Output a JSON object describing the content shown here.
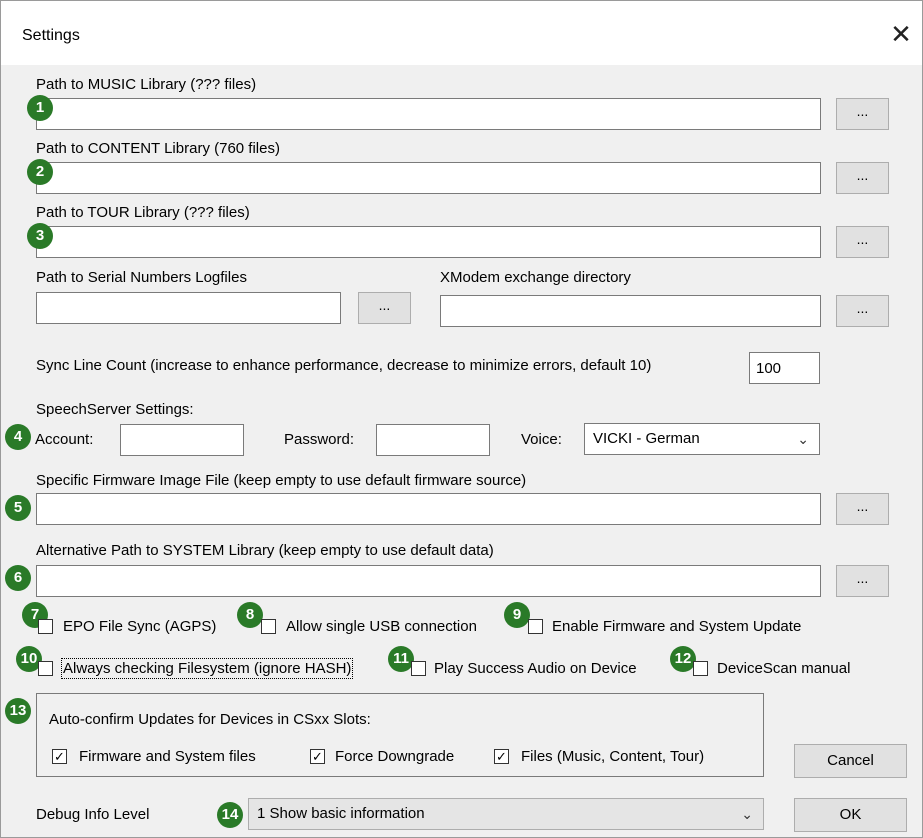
{
  "window": {
    "title": "Settings",
    "close_glyph": "✕"
  },
  "browse_label": "...",
  "music": {
    "label": "Path to MUSIC Library (??? files)",
    "value": "",
    "badge": "1"
  },
  "content": {
    "label": "Path to CONTENT Library (760 files)",
    "value": "",
    "badge": "2"
  },
  "tour": {
    "label": "Path to TOUR Library (??? files)",
    "value": "",
    "badge": "3"
  },
  "serial": {
    "label": "Path to Serial Numbers Logfiles",
    "value": ""
  },
  "xmodem": {
    "label": "XModem exchange directory",
    "value": ""
  },
  "sync": {
    "label": "Sync Line Count (increase to enhance performance, decrease to minimize errors, default 10)",
    "value": "100"
  },
  "speech": {
    "heading": "SpeechServer Settings:",
    "badge": "4",
    "account_label": "Account:",
    "account_value": "",
    "password_label": "Password:",
    "password_value": "",
    "voice_label": "Voice:",
    "voice_value": "VICKI - German"
  },
  "firmware": {
    "label": "Specific Firmware Image File (keep empty to use default firmware source)",
    "value": "",
    "badge": "5"
  },
  "system": {
    "label": "Alternative Path to SYSTEM Library (keep empty to use default data)",
    "value": "",
    "badge": "6"
  },
  "options": {
    "epo": {
      "label": "EPO File Sync (AGPS)",
      "badge": "7",
      "checked": false
    },
    "single_usb": {
      "label": "Allow single USB connection",
      "badge": "8",
      "checked": false
    },
    "enable_update": {
      "label": "Enable Firmware and System Update",
      "badge": "9",
      "checked": false
    },
    "always_check": {
      "label": "Always checking Filesystem (ignore HASH)",
      "badge": "10",
      "checked": false
    },
    "play_audio": {
      "label": "Play Success Audio on Device",
      "badge": "11",
      "checked": false
    },
    "devicescan": {
      "label": "DeviceScan manual",
      "badge": "12",
      "checked": false
    }
  },
  "autoconfirm": {
    "title": "Auto-confirm Updates for Devices in CSxx Slots:",
    "badge": "13",
    "firmware_files": {
      "label": "Firmware and System files",
      "checked": true
    },
    "force_downgrade": {
      "label": "Force Downgrade",
      "checked": true
    },
    "files": {
      "label": "Files (Music, Content, Tour)",
      "checked": true
    }
  },
  "debug": {
    "label": "Debug Info Level",
    "badge": "14",
    "value": "1 Show basic information"
  },
  "buttons": {
    "cancel": "Cancel",
    "ok": "OK"
  },
  "check_glyph": "✓",
  "chevron_glyph": "⌄"
}
